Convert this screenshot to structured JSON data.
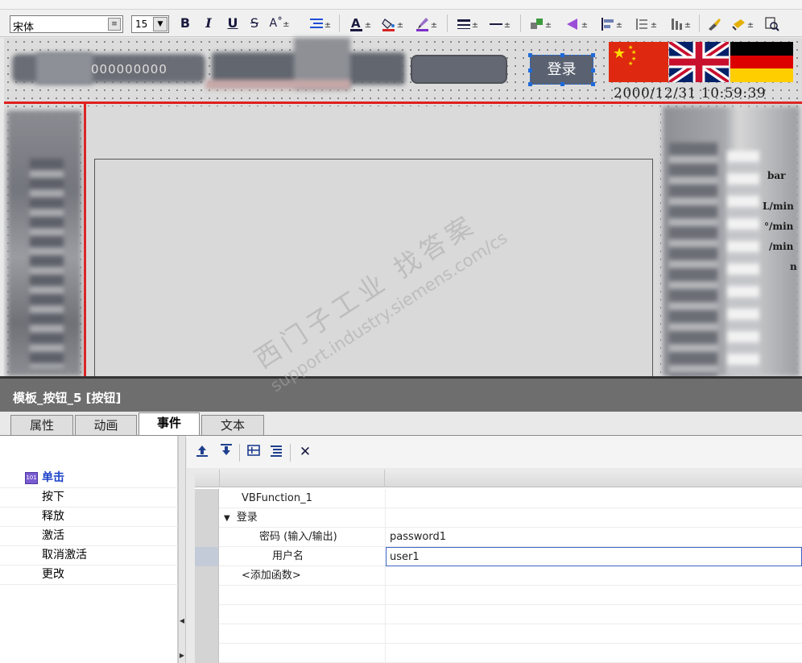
{
  "toolbar": {
    "font_name": "宋体",
    "font_size": "15",
    "bold": "B",
    "italic": "I",
    "underline": "U",
    "strike": "S",
    "superscript": "A˚",
    "pm": "±"
  },
  "hmi": {
    "header_digits": "000000000",
    "login_button": "登录",
    "datetime": "2000/12/31 10:59:39",
    "units": [
      "bar",
      "L/min",
      "°/min",
      "/min",
      "n"
    ],
    "colors": {
      "accent_red": "#e02020",
      "flag_cn": "#de2910",
      "flag_uk_blue": "#012169",
      "flag_uk_red": "#c8102e"
    }
  },
  "watermark": {
    "line1": "西门子工业  找答案",
    "line2": "support.industry.siemens.com/cs"
  },
  "object": {
    "title": "模板_按钮_5 [按钮]"
  },
  "tabs": [
    {
      "label": "属性"
    },
    {
      "label": "动画"
    },
    {
      "label": "事件"
    },
    {
      "label": "文本"
    }
  ],
  "events": [
    {
      "label": "单击",
      "selected": true,
      "icon": "click-event-icon"
    },
    {
      "label": "按下"
    },
    {
      "label": "释放"
    },
    {
      "label": "激活"
    },
    {
      "label": "取消激活"
    },
    {
      "label": "更改"
    }
  ],
  "function_toolbar": {
    "icons": [
      "move-up-icon",
      "move-down-icon",
      "collapse-icon",
      "expand-icon",
      "delete-icon"
    ],
    "delete_glyph": "✕"
  },
  "function_list": {
    "rows": [
      {
        "name": "VBFunction_1",
        "value": ""
      },
      {
        "name": "登录",
        "value": "",
        "expanded": true
      },
      {
        "name": "密码 (输入/输出)",
        "value": "password1"
      },
      {
        "name": "用户名",
        "value": "user1"
      },
      {
        "name": "<添加函数>",
        "value": ""
      }
    ]
  }
}
